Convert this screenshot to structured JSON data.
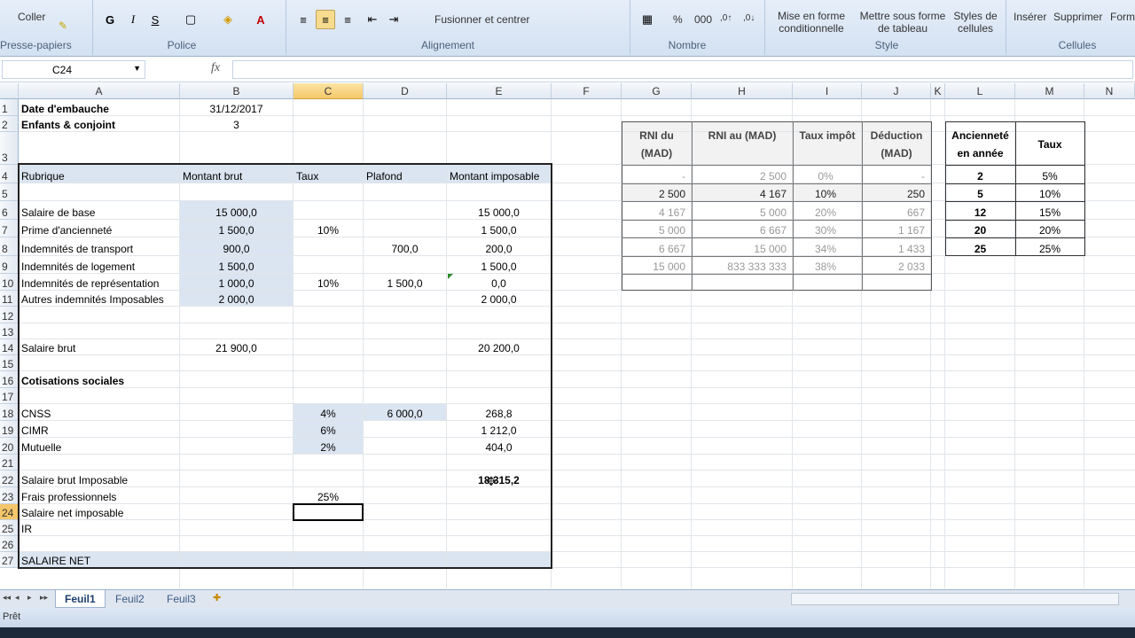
{
  "ribbon": {
    "clipboard": {
      "coller": "Coller",
      "label": "Presse-papiers"
    },
    "font": {
      "bold": "G",
      "italic": "I",
      "underline": "S",
      "label": "Police"
    },
    "alignment": {
      "merge": "Fusionner et centrer",
      "label": "Alignement"
    },
    "number": {
      "percent": "%",
      "thousands": "000",
      "label": "Nombre"
    },
    "styles": {
      "cond_format": "Mise en forme conditionnelle",
      "table_format": "Mettre sous forme de tableau",
      "cell_styles": "Styles de cellules",
      "label": "Style"
    },
    "cells": {
      "insert": "Insérer",
      "delete": "Supprimer",
      "format": "Form",
      "label": "Cellules"
    }
  },
  "formula_bar": {
    "name_box": "C24",
    "fx": "fx",
    "value": ""
  },
  "columns": [
    "A",
    "B",
    "C",
    "D",
    "E",
    "F",
    "G",
    "H",
    "I",
    "J",
    "K",
    "L",
    "M",
    "N"
  ],
  "rows": [
    "1",
    "2",
    "3",
    "4",
    "5",
    "6",
    "7",
    "8",
    "9",
    "10",
    "11",
    "12",
    "13",
    "14",
    "15",
    "16",
    "17",
    "18",
    "19",
    "20",
    "21",
    "22",
    "23",
    "24",
    "25",
    "26",
    "27"
  ],
  "sheet": {
    "a1": "Date d'embauche",
    "b1": "31/12/2017",
    "a2": "Enfants & conjoint",
    "b2": "3",
    "hdr": [
      "Rubrique",
      "Montant brut",
      "Taux",
      "Plafond",
      "Montant imposable"
    ],
    "r6": [
      "Salaire de base",
      "15 000,0",
      "",
      "",
      "15 000,0"
    ],
    "r7": [
      "Prime d'ancienneté",
      "1 500,0",
      "10%",
      "",
      "1 500,0"
    ],
    "r8": [
      "Indemnités de transport",
      "900,0",
      "",
      "700,0",
      "200,0"
    ],
    "r9": [
      "Indemnités de logement",
      "1 500,0",
      "",
      "",
      "1 500,0"
    ],
    "r10": [
      "Indemnités de représentation",
      "1 000,0",
      "10%",
      "1 500,0",
      "0,0"
    ],
    "r11": [
      "Autres indemnités Imposables",
      "2 000,0",
      "",
      "",
      "2 000,0"
    ],
    "r14": [
      "Salaire brut",
      "21 900,0",
      "",
      "",
      "20 200,0"
    ],
    "a16": "Cotisations sociales",
    "r18": [
      "CNSS",
      "",
      "4%",
      "6 000,0",
      "268,8"
    ],
    "r19": [
      "CIMR",
      "",
      "6%",
      "",
      "1 212,0"
    ],
    "r20": [
      "Mutuelle",
      "",
      "2%",
      "",
      "404,0"
    ],
    "a22": "Salaire brut Imposable",
    "e22": "18 315,2",
    "a23": "Frais professionnels",
    "c23": "25%",
    "a24": "Salaire net imposable",
    "a25": "IR",
    "a27": "SALAIRE NET"
  },
  "ir_table": {
    "headers": [
      "RNI du (MAD)",
      "RNI au (MAD)",
      "Taux impôt",
      "Déduction (MAD)"
    ],
    "rows": [
      [
        "-",
        "2 500",
        "0%",
        "-"
      ],
      [
        "2 500",
        "4 167",
        "10%",
        "250"
      ],
      [
        "4 167",
        "5 000",
        "20%",
        "667"
      ],
      [
        "5 000",
        "6 667",
        "30%",
        "1 167"
      ],
      [
        "6 667",
        "15 000",
        "34%",
        "1 433"
      ],
      [
        "15 000",
        "833 333 333",
        "38%",
        "2 033"
      ]
    ]
  },
  "anc_table": {
    "headers": [
      "Ancienneté en année",
      "Taux"
    ],
    "rows": [
      [
        "2",
        "5%"
      ],
      [
        "5",
        "10%"
      ],
      [
        "12",
        "15%"
      ],
      [
        "20",
        "20%"
      ],
      [
        "25",
        "25%"
      ]
    ]
  },
  "tabs": [
    "Feuil1",
    "Feuil2",
    "Feuil3"
  ],
  "status": "Prêt"
}
